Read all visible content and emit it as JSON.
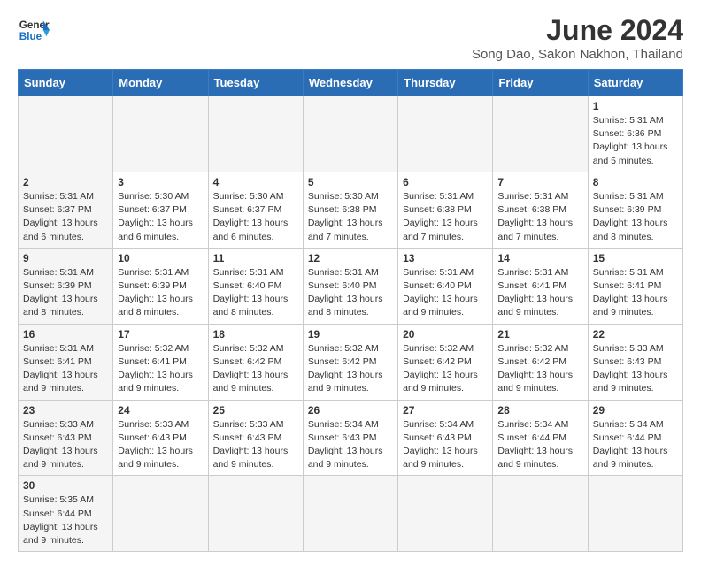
{
  "header": {
    "logo_general": "General",
    "logo_blue": "Blue",
    "month_title": "June 2024",
    "subtitle": "Song Dao, Sakon Nakhon, Thailand"
  },
  "weekdays": [
    "Sunday",
    "Monday",
    "Tuesday",
    "Wednesday",
    "Thursday",
    "Friday",
    "Saturday"
  ],
  "weeks": [
    [
      {
        "day": "",
        "info": "",
        "shaded": true
      },
      {
        "day": "",
        "info": "",
        "shaded": true
      },
      {
        "day": "",
        "info": "",
        "shaded": true
      },
      {
        "day": "",
        "info": "",
        "shaded": true
      },
      {
        "day": "",
        "info": "",
        "shaded": true
      },
      {
        "day": "",
        "info": "",
        "shaded": true
      },
      {
        "day": "1",
        "info": "Sunrise: 5:31 AM\nSunset: 6:36 PM\nDaylight: 13 hours and 5 minutes.",
        "shaded": false
      }
    ],
    [
      {
        "day": "2",
        "info": "Sunrise: 5:31 AM\nSunset: 6:37 PM\nDaylight: 13 hours and 6 minutes.",
        "shaded": true
      },
      {
        "day": "3",
        "info": "Sunrise: 5:30 AM\nSunset: 6:37 PM\nDaylight: 13 hours and 6 minutes.",
        "shaded": false
      },
      {
        "day": "4",
        "info": "Sunrise: 5:30 AM\nSunset: 6:37 PM\nDaylight: 13 hours and 6 minutes.",
        "shaded": false
      },
      {
        "day": "5",
        "info": "Sunrise: 5:30 AM\nSunset: 6:38 PM\nDaylight: 13 hours and 7 minutes.",
        "shaded": false
      },
      {
        "day": "6",
        "info": "Sunrise: 5:31 AM\nSunset: 6:38 PM\nDaylight: 13 hours and 7 minutes.",
        "shaded": false
      },
      {
        "day": "7",
        "info": "Sunrise: 5:31 AM\nSunset: 6:38 PM\nDaylight: 13 hours and 7 minutes.",
        "shaded": false
      },
      {
        "day": "8",
        "info": "Sunrise: 5:31 AM\nSunset: 6:39 PM\nDaylight: 13 hours and 8 minutes.",
        "shaded": false
      }
    ],
    [
      {
        "day": "9",
        "info": "Sunrise: 5:31 AM\nSunset: 6:39 PM\nDaylight: 13 hours and 8 minutes.",
        "shaded": true
      },
      {
        "day": "10",
        "info": "Sunrise: 5:31 AM\nSunset: 6:39 PM\nDaylight: 13 hours and 8 minutes.",
        "shaded": false
      },
      {
        "day": "11",
        "info": "Sunrise: 5:31 AM\nSunset: 6:40 PM\nDaylight: 13 hours and 8 minutes.",
        "shaded": false
      },
      {
        "day": "12",
        "info": "Sunrise: 5:31 AM\nSunset: 6:40 PM\nDaylight: 13 hours and 8 minutes.",
        "shaded": false
      },
      {
        "day": "13",
        "info": "Sunrise: 5:31 AM\nSunset: 6:40 PM\nDaylight: 13 hours and 9 minutes.",
        "shaded": false
      },
      {
        "day": "14",
        "info": "Sunrise: 5:31 AM\nSunset: 6:41 PM\nDaylight: 13 hours and 9 minutes.",
        "shaded": false
      },
      {
        "day": "15",
        "info": "Sunrise: 5:31 AM\nSunset: 6:41 PM\nDaylight: 13 hours and 9 minutes.",
        "shaded": false
      }
    ],
    [
      {
        "day": "16",
        "info": "Sunrise: 5:31 AM\nSunset: 6:41 PM\nDaylight: 13 hours and 9 minutes.",
        "shaded": true
      },
      {
        "day": "17",
        "info": "Sunrise: 5:32 AM\nSunset: 6:41 PM\nDaylight: 13 hours and 9 minutes.",
        "shaded": false
      },
      {
        "day": "18",
        "info": "Sunrise: 5:32 AM\nSunset: 6:42 PM\nDaylight: 13 hours and 9 minutes.",
        "shaded": false
      },
      {
        "day": "19",
        "info": "Sunrise: 5:32 AM\nSunset: 6:42 PM\nDaylight: 13 hours and 9 minutes.",
        "shaded": false
      },
      {
        "day": "20",
        "info": "Sunrise: 5:32 AM\nSunset: 6:42 PM\nDaylight: 13 hours and 9 minutes.",
        "shaded": false
      },
      {
        "day": "21",
        "info": "Sunrise: 5:32 AM\nSunset: 6:42 PM\nDaylight: 13 hours and 9 minutes.",
        "shaded": false
      },
      {
        "day": "22",
        "info": "Sunrise: 5:33 AM\nSunset: 6:43 PM\nDaylight: 13 hours and 9 minutes.",
        "shaded": false
      }
    ],
    [
      {
        "day": "23",
        "info": "Sunrise: 5:33 AM\nSunset: 6:43 PM\nDaylight: 13 hours and 9 minutes.",
        "shaded": true
      },
      {
        "day": "24",
        "info": "Sunrise: 5:33 AM\nSunset: 6:43 PM\nDaylight: 13 hours and 9 minutes.",
        "shaded": false
      },
      {
        "day": "25",
        "info": "Sunrise: 5:33 AM\nSunset: 6:43 PM\nDaylight: 13 hours and 9 minutes.",
        "shaded": false
      },
      {
        "day": "26",
        "info": "Sunrise: 5:34 AM\nSunset: 6:43 PM\nDaylight: 13 hours and 9 minutes.",
        "shaded": false
      },
      {
        "day": "27",
        "info": "Sunrise: 5:34 AM\nSunset: 6:43 PM\nDaylight: 13 hours and 9 minutes.",
        "shaded": false
      },
      {
        "day": "28",
        "info": "Sunrise: 5:34 AM\nSunset: 6:44 PM\nDaylight: 13 hours and 9 minutes.",
        "shaded": false
      },
      {
        "day": "29",
        "info": "Sunrise: 5:34 AM\nSunset: 6:44 PM\nDaylight: 13 hours and 9 minutes.",
        "shaded": false
      }
    ],
    [
      {
        "day": "30",
        "info": "Sunrise: 5:35 AM\nSunset: 6:44 PM\nDaylight: 13 hours and 9 minutes.",
        "shaded": true
      },
      {
        "day": "",
        "info": "",
        "shaded": true
      },
      {
        "day": "",
        "info": "",
        "shaded": true
      },
      {
        "day": "",
        "info": "",
        "shaded": true
      },
      {
        "day": "",
        "info": "",
        "shaded": true
      },
      {
        "day": "",
        "info": "",
        "shaded": true
      },
      {
        "day": "",
        "info": "",
        "shaded": true
      }
    ]
  ]
}
